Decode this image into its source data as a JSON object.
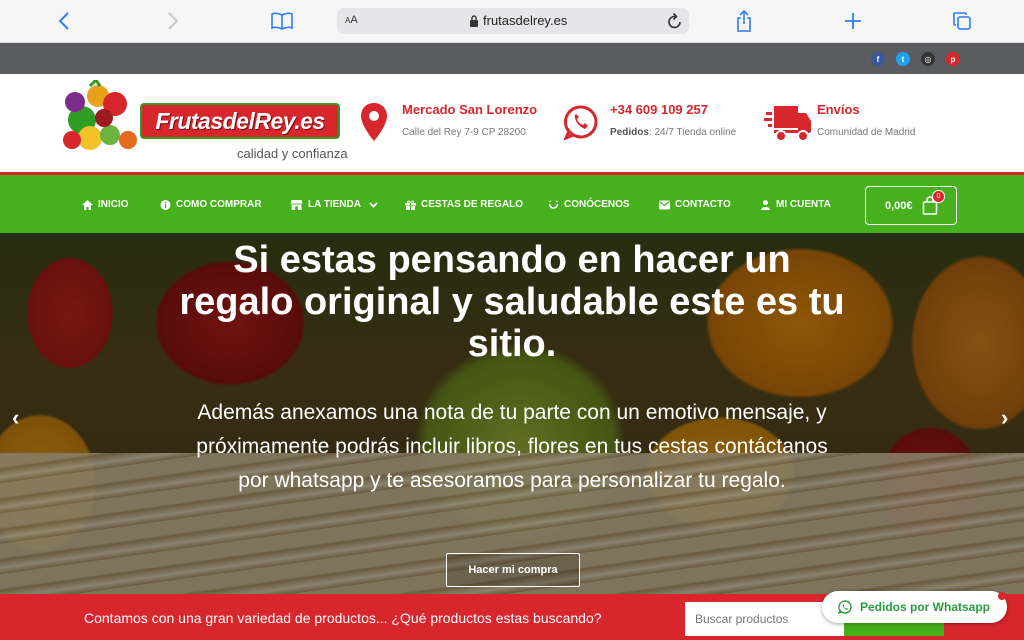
{
  "browser": {
    "text_size_label": "AA",
    "url": "frutasdelrey.es"
  },
  "colors": {
    "brand_red": "#d7262c",
    "brand_green": "#46b01d",
    "topbar": "#5a5c5f"
  },
  "social": [
    {
      "name": "facebook-icon",
      "glyph": "f",
      "color": "#3b5998"
    },
    {
      "name": "twitter-icon",
      "glyph": "t",
      "color": "#1da1f2"
    },
    {
      "name": "instagram-icon",
      "glyph": "◎",
      "color": "#333333"
    },
    {
      "name": "pinterest-icon",
      "glyph": "p",
      "color": "#d7262c"
    }
  ],
  "header": {
    "logo_text": "FrutasdelRey.es",
    "tagline": "calidad y confianza",
    "location": {
      "title": "Mercado San Lorenzo",
      "sub": "Calle del Rey 7-9 CP 28200"
    },
    "phone": {
      "title": "+34 609 109 257",
      "sub_label": "Pedidos",
      "sub": ": 24/7 Tienda online"
    },
    "shipping": {
      "title": "Envíos",
      "sub": "Comunidad de Madrid"
    }
  },
  "nav": {
    "items": [
      {
        "label": "INICIO"
      },
      {
        "label": "COMO COMPRAR"
      },
      {
        "label": "LA TIENDA"
      },
      {
        "label": "CESTAS DE REGALO"
      },
      {
        "label": "CONÓCENOS"
      },
      {
        "label": "CONTACTO"
      },
      {
        "label": "MI CUENTA"
      }
    ],
    "cart_amount": "0,00€",
    "cart_count": "0"
  },
  "hero": {
    "title": "Si estas pensando en hacer un regalo original y saludable este es tu sitio.",
    "text": "Además anexamos una nota de tu parte con un emotivo mensaje, y próximamente podrás incluir libros, flores en tus cestas contáctanos por whatsapp y te asesoramos para personalizar tu regalo.",
    "button": "Hacer mi compra",
    "prev": "‹",
    "next": "›"
  },
  "search": {
    "question": "Contamos con una gran variedad de productos... ¿Qué productos estas buscando?",
    "placeholder": "Buscar productos"
  },
  "whatsapp": {
    "label": "Pedidos por Whatsapp"
  }
}
